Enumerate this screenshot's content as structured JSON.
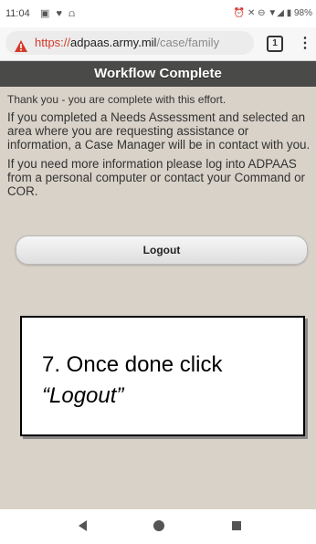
{
  "status_bar": {
    "time": "11:04",
    "left_icons": "▣ ♥ ⩍",
    "right_icons": "⏰ ✕ ⊖ ▼◢ ▮ 98%"
  },
  "browser": {
    "url_scheme": "https://",
    "url_host": "adpaas.army.mil",
    "url_path": "/case/family",
    "tab_count": "1",
    "warning_color": "#d23a2a"
  },
  "page": {
    "header_title": "Workflow Complete",
    "thank_you": "Thank you - you are complete with this effort.",
    "needs_assessment": "If you completed a Needs Assessment and selected an area where you are requesting assistance or information, a Case Manager will be in contact with you.",
    "more_info": "If you need more information please log into ADPAAS from a personal computer or contact your Command or COR.",
    "logout_label": "Logout"
  },
  "callout": {
    "line1": "7. Once done click",
    "line2": "“Logout”"
  },
  "nav_bar": {
    "back_icon": "triangle-back",
    "home_icon": "circle-home",
    "recents_icon": "square-recents"
  }
}
